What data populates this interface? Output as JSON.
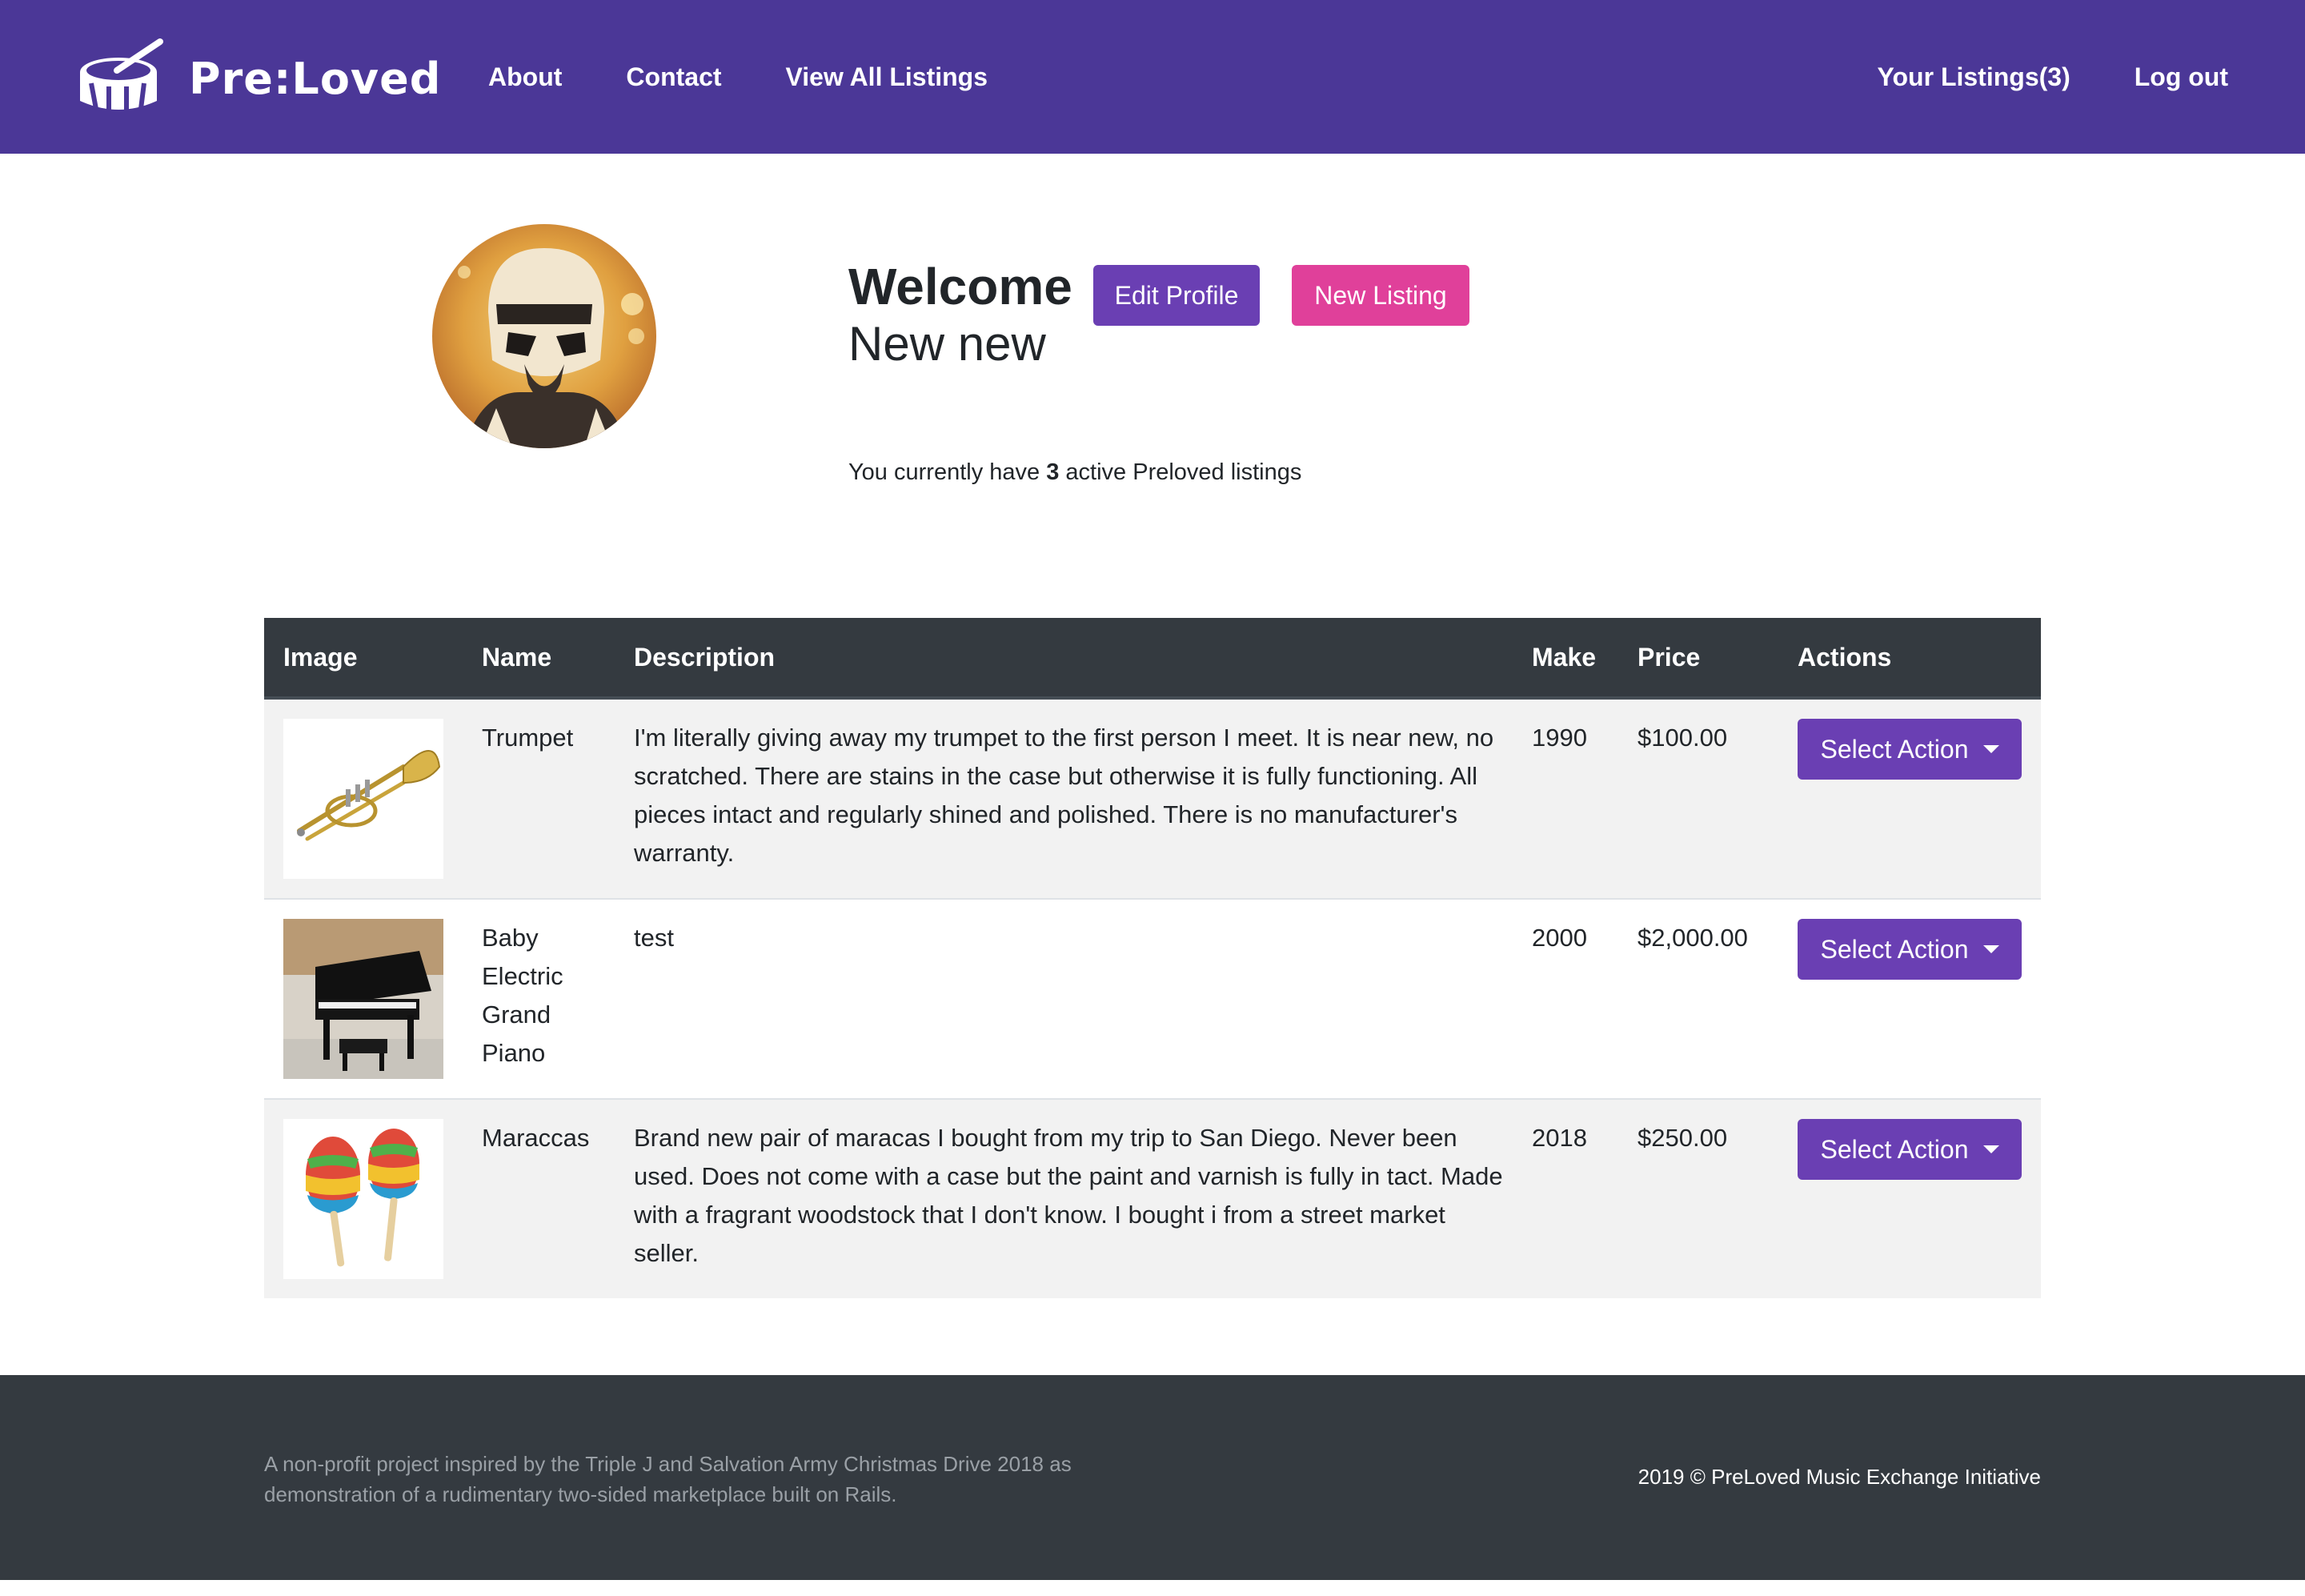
{
  "brand": {
    "name": "Pre:Loved"
  },
  "nav": {
    "left": [
      "About",
      "Contact",
      "View All Listings"
    ],
    "right": [
      "Your Listings(3)",
      "Log out"
    ]
  },
  "profile": {
    "welcome": "Welcome",
    "name": "New new",
    "edit_button": "Edit Profile",
    "new_button": "New Listing",
    "active_prefix": "You currently have",
    "active_count": "3",
    "active_suffix": "active Preloved listings"
  },
  "table": {
    "headers": [
      "Image",
      "Name",
      "Description",
      "Make",
      "Price",
      "Actions"
    ],
    "rows": [
      {
        "image_icon": "trumpet-image",
        "name": "Trumpet",
        "description": "I'm literally giving away my trumpet to the first person I meet. It is near new, no scratched. There are stains in the case but otherwise it is fully functioning. All pieces intact and regularly shined and polished. There is no manufacturer's warranty.",
        "make": "1990",
        "price": "$100.00",
        "action": "Select Action"
      },
      {
        "image_icon": "piano-image",
        "name": "Baby Electric Grand Piano",
        "description": "test",
        "make": "2000",
        "price": "$2,000.00",
        "action": "Select Action"
      },
      {
        "image_icon": "maracas-image",
        "name": "Maraccas",
        "description": "Brand new pair of maracas I bought from my trip to San Diego. Never been used. Does not come with a case but the paint and varnish is fully in tact. Made with a fragrant woodstock that I don't know. I bought i from a street market seller.",
        "make": "2018",
        "price": "$250.00",
        "action": "Select Action"
      }
    ]
  },
  "footer": {
    "note": "A non-profit project inspired by the Triple J and Salvation Army Christmas Drive 2018 as demonstration of a rudimentary two-sided marketplace built on Rails.",
    "copyright": "2019 © PreLoved Music Exchange Initiative"
  },
  "colors": {
    "navbar": "#4b3797",
    "edit_button": "#6a3fb3",
    "new_button": "#e0409a",
    "table_header": "#343a40",
    "footer": "#343a40"
  }
}
